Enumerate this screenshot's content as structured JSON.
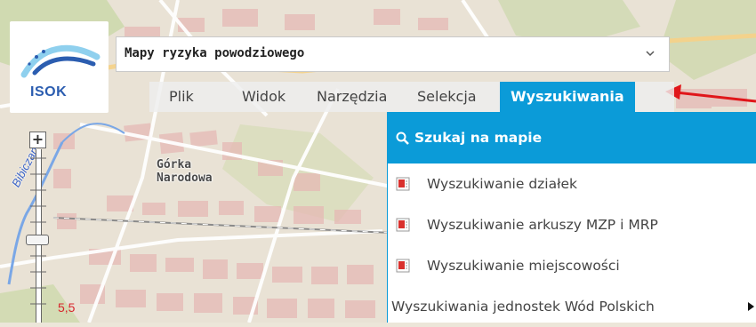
{
  "logo": {
    "text": "ISOK"
  },
  "layer_select": {
    "value": "Mapy ryzyka powodziowego"
  },
  "menubar": {
    "items": [
      {
        "label": "Plik"
      },
      {
        "label": "Widok"
      },
      {
        "label": "Narzędzia"
      },
      {
        "label": "Selekcja"
      },
      {
        "label": "Wyszukiwania",
        "active": true
      }
    ]
  },
  "search_menu": {
    "items": [
      {
        "label": "Szukaj na mapie",
        "icon": "magnifier-icon",
        "highlighted": true
      },
      {
        "label": "Wyszukiwanie działek",
        "icon": "form-icon"
      },
      {
        "label": "Wyszukiwanie arkuszy MZP i MRP",
        "icon": "form-icon"
      },
      {
        "label": "Wyszukiwanie miejscowości",
        "icon": "form-icon"
      },
      {
        "label": "Wyszukiwania jednostek Wód Polskich",
        "icon": "submenu-arrow-icon",
        "has_submenu": true
      }
    ]
  },
  "map": {
    "place_label": [
      "Górka",
      "Narodowa"
    ],
    "river_label": "Bibiczan",
    "scale_number": "5,5"
  },
  "colors": {
    "accent": "#0b9bd8",
    "annotation_arrow": "#e0161a",
    "logo_blue": "#2b5db0"
  }
}
